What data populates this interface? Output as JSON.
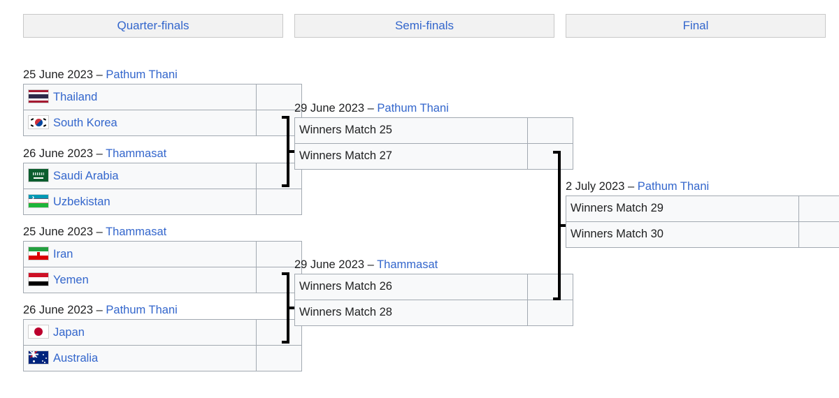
{
  "rounds": [
    {
      "id": "quarter-finals",
      "label": "Quarter-finals"
    },
    {
      "id": "semi-finals",
      "label": "Semi-finals"
    },
    {
      "id": "final",
      "label": "Final"
    }
  ],
  "separator": "–",
  "colors": {
    "link": "#3366cc",
    "text": "#202122",
    "header_bg": "#f2f2f2",
    "header_border": "#c8c8c8",
    "cell_bg": "#f8f9fa",
    "cell_border": "#a2a9b1",
    "connector": "#000000"
  },
  "matches": {
    "qf1": {
      "date": "25 June 2023",
      "venue": "Pathum Thani",
      "rows": [
        {
          "team": "Thailand",
          "flag": "thailand-flag",
          "score": ""
        },
        {
          "team": "South Korea",
          "flag": "south-korea-flag",
          "score": ""
        }
      ]
    },
    "qf2": {
      "date": "26 June 2023",
      "venue": "Thammasat",
      "rows": [
        {
          "team": "Saudi Arabia",
          "flag": "saudi-arabia-flag",
          "score": ""
        },
        {
          "team": "Uzbekistan",
          "flag": "uzbekistan-flag",
          "score": ""
        }
      ]
    },
    "qf3": {
      "date": "25 June 2023",
      "venue": "Thammasat",
      "rows": [
        {
          "team": "Iran",
          "flag": "iran-flag",
          "score": ""
        },
        {
          "team": "Yemen",
          "flag": "yemen-flag",
          "score": ""
        }
      ]
    },
    "qf4": {
      "date": "26 June 2023",
      "venue": "Pathum Thani",
      "rows": [
        {
          "team": "Japan",
          "flag": "japan-flag",
          "score": ""
        },
        {
          "team": "Australia",
          "flag": "australia-flag",
          "score": ""
        }
      ]
    },
    "sf1": {
      "date": "29 June 2023",
      "venue": "Pathum Thani",
      "rows": [
        {
          "team": "Winners Match 25",
          "flag": "",
          "score": ""
        },
        {
          "team": "Winners Match 27",
          "flag": "",
          "score": ""
        }
      ]
    },
    "sf2": {
      "date": "29 June 2023",
      "venue": "Thammasat",
      "rows": [
        {
          "team": "Winners Match 26",
          "flag": "",
          "score": ""
        },
        {
          "team": "Winners Match 28",
          "flag": "",
          "score": ""
        }
      ]
    },
    "f1": {
      "date": "2 July 2023",
      "venue": "Pathum Thani",
      "rows": [
        {
          "team": "Winners Match 29",
          "flag": "",
          "score": ""
        },
        {
          "team": "Winners Match 30",
          "flag": "",
          "score": ""
        }
      ]
    }
  }
}
